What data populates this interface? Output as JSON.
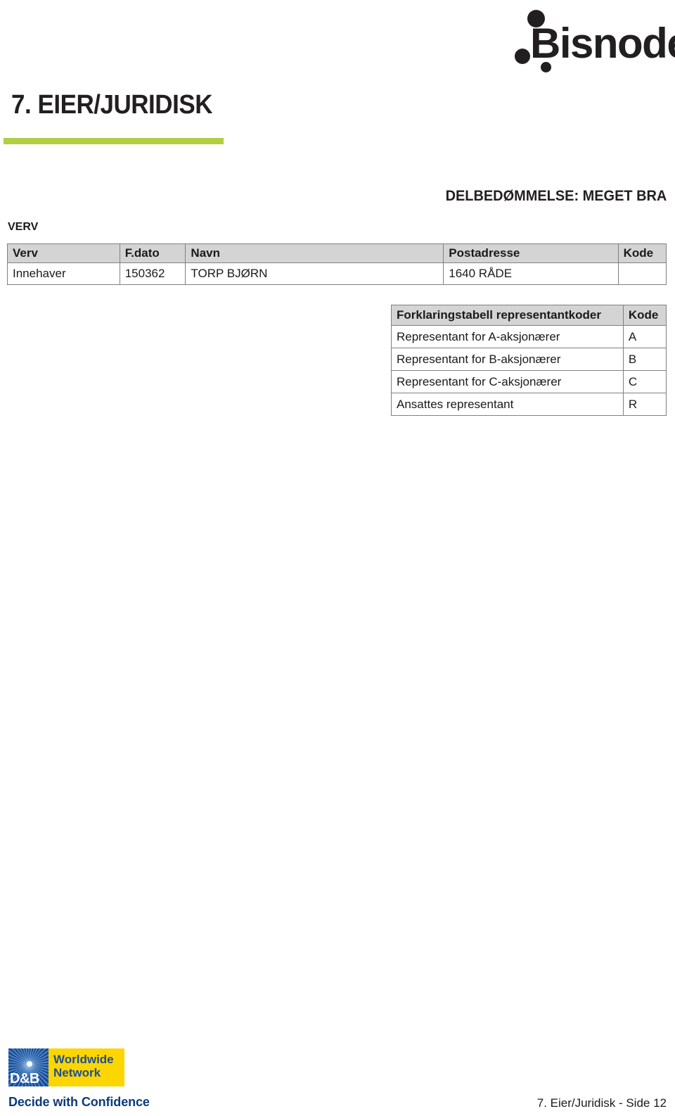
{
  "brand": {
    "logo_text": "Bisnode",
    "dots": [
      "dot-large",
      "dot-medium",
      "dot-small"
    ],
    "accent_green": "#b2ce42",
    "ink": "#231f20"
  },
  "section": {
    "title": "7. EIER/JURIDISK",
    "assessment_heading": "DELBEDØMMELSE: MEGET BRA",
    "group_label": "VERV"
  },
  "verv_table": {
    "headers": [
      "Verv",
      "F.dato",
      "Navn",
      "Postadresse",
      "Kode"
    ],
    "rows": [
      {
        "verv": "Innehaver",
        "fdato": "150362",
        "navn": "TORP BJØRN",
        "postadresse": "1640 RÅDE",
        "kode": ""
      }
    ]
  },
  "forklaring_table": {
    "headers": [
      "Forklaringstabell representantkoder",
      "Kode"
    ],
    "rows": [
      {
        "beskrivelse": "Representant for A-aksjonærer",
        "kode": "A"
      },
      {
        "beskrivelse": "Representant for B-aksjonærer",
        "kode": "B"
      },
      {
        "beskrivelse": "Representant for C-aksjonærer",
        "kode": "C"
      },
      {
        "beskrivelse": "Ansattes representant",
        "kode": "R"
      }
    ]
  },
  "footer": {
    "dnb_mark": "D&B",
    "dnb_line1": "Worldwide",
    "dnb_line2": "Network",
    "tagline": "Decide with Confidence",
    "page_label": "7. Eier/Juridisk - Side 12",
    "dnb_blue": "#1a4f9c",
    "dnb_yellow": "#fdd500"
  }
}
